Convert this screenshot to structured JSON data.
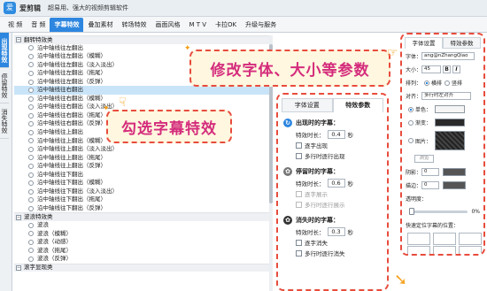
{
  "app": {
    "icon_text": "爱",
    "name": "爱剪辑",
    "slogan": "超易用、强大的视频剪辑软件"
  },
  "menu": [
    "视 频",
    "音 频",
    "字幕特效",
    "叠加素材",
    "转场特效",
    "画面风格",
    "M T V",
    "卡拉OK",
    "升级与服务"
  ],
  "sidetabs": [
    "出现特效",
    "停留特效",
    "消失特效"
  ],
  "groups": [
    {
      "label": "翻转特效类",
      "items": [
        "沿中轴线往左翻出",
        "沿中轴线往左翻出（模糊）",
        "沿中轴线往左翻出（淡入淡出）",
        "沿中轴线往左翻出（拖尾）",
        "沿中轴线往左翻出（反弹）",
        "沿中轴线往右翻出",
        "沿中轴线往右翻出（模糊）",
        "沿中轴线往右翻出（淡入淡出）",
        "沿中轴线往右翻出（拖尾）",
        "沿中轴线往右翻出（反弹）",
        "沿中轴线往上翻出",
        "沿中轴线往上翻出（模糊）",
        "沿中轴线往上翻出（淡入淡出）",
        "沿中轴线往上翻出（拖尾）",
        "沿中轴线往上翻出（反弹）",
        "沿中轴线往下翻出",
        "沿中轴线往下翻出（模糊）",
        "沿中轴线往下翻出（淡入淡出）",
        "沿中轴线往下翻出（拖尾）",
        "沿中轴线往下翻出（反弹）"
      ]
    },
    {
      "label": "波浪特效类",
      "items": [
        "波浪",
        "波浪（模糊）",
        "波浪（动感）",
        "波浪（拖尾）",
        "波浪（反弹）"
      ]
    },
    {
      "label": "滚字显现类",
      "items": []
    }
  ],
  "selected_item": "沿中轴线往左翻出",
  "callouts": {
    "font": "修改字体、大小等参数",
    "effect": "勾选字幕特效"
  },
  "mid_panel": {
    "tabs": [
      "字体设置",
      "特效参数"
    ],
    "sections": [
      {
        "title": "出现时的字幕：",
        "duration_label": "特效时长：",
        "duration": "0.4",
        "unit": "秒",
        "options": [
          {
            "label": "逐字出现",
            "enabled": true
          },
          {
            "label": "多行时逐行出现",
            "enabled": true
          }
        ]
      },
      {
        "title": "停留时的字幕：",
        "duration_label": "特效时长：",
        "duration": "0.6",
        "unit": "秒",
        "options": [
          {
            "label": "逐字展示",
            "enabled": false
          },
          {
            "label": "多行时逐行展示",
            "enabled": false
          }
        ]
      },
      {
        "title": "消失时的字幕：",
        "duration_label": "特效时长：",
        "duration": "0.3",
        "unit": "秒",
        "options": [
          {
            "label": "逐字消失",
            "enabled": true
          },
          {
            "label": "多行时逐行消失",
            "enabled": true
          }
        ]
      }
    ]
  },
  "right_panel": {
    "tabs": [
      "字体设置",
      "特效参数"
    ],
    "font_label": "字体：",
    "font_value": "ang@nZhangQiao",
    "size_label": "大小：",
    "size_value": "45",
    "bold": "B",
    "italic": "I",
    "layout_label": "排列：",
    "horizontal": "横排",
    "vertical": "竖排",
    "align_label": "对齐：",
    "align_value": "多行时左对齐",
    "solid_label": "单色：",
    "gradient_label": "渐变：",
    "image_label": "图片：",
    "browse": "浏览",
    "shadow_label": "阴影：",
    "shadow_value": "0",
    "stroke_label": "描边：",
    "stroke_value": "0",
    "opacity_label": "透明度：",
    "opacity_value": "0%",
    "position_label": "快速定位字幕的位置：",
    "colors": {
      "solid": "#f5f5f5",
      "gradient": "#2a2a2a",
      "shadow": "#555555",
      "stroke": "#555555"
    }
  },
  "colors": {
    "accent": "#2d86df",
    "callout_border": "#e84c3d",
    "callout_text": "#d42c7c",
    "selected_row": "#c9e4f8"
  }
}
